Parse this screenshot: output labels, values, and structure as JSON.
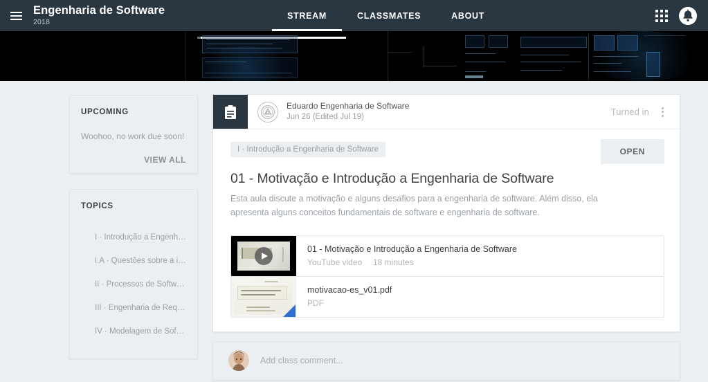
{
  "topbar": {
    "menu_icon": "hamburger-menu-icon",
    "class_name": "Engenharia de Software",
    "class_year": "2018",
    "tabs": [
      {
        "label": "STREAM",
        "active": true
      },
      {
        "label": "CLASSMATES",
        "active": false
      },
      {
        "label": "ABOUT",
        "active": false
      }
    ],
    "apps_icon": "apps-grid-icon",
    "account_icon": "account-avatar-icon"
  },
  "banner": {
    "alt": "class-banner-image"
  },
  "sidebar": {
    "upcoming": {
      "heading": "UPCOMING",
      "message": "Woohoo, no work due soon!",
      "view_all_label": "VIEW ALL"
    },
    "topics": {
      "heading": "TOPICS",
      "items": [
        {
          "label": "I · Introdução a Engenharia..."
        },
        {
          "label": "I.A · Questões sobre a intro..."
        },
        {
          "label": "II · Processos de Software"
        },
        {
          "label": "III · Engenharia de Requisit..."
        },
        {
          "label": "IV · Modelagem de Software"
        }
      ]
    }
  },
  "post": {
    "type_icon": "assignment-clipboard-icon",
    "avatar_icon": "school-seal-icon",
    "author": "Eduardo Engenharia de Software",
    "date": "Jun 26 (Edited Jul 19)",
    "status": "Turned in",
    "menu_icon": "more-options-kebab-icon",
    "topic_chip": "I · Introdução a Engenharia de Software",
    "open_label": "OPEN",
    "title": "01 - Motivação e Introdução a Engenharia de Software",
    "description": "Esta aula discute a motivação e alguns desafios para a engenharia de software. Além disso, ela apresenta alguns conceitos fundamentais de software e engenharia de software.",
    "attachments": [
      {
        "thumb": "video-play-thumbnail",
        "title": "01 - Motivação e Introdução a Engenharia de Software",
        "meta_type": "YouTube video",
        "meta_duration": "18 minutes"
      },
      {
        "thumb": "pdf-document-thumbnail",
        "title": "motivacao-es_v01.pdf",
        "meta_type": "PDF",
        "meta_duration": ""
      }
    ]
  },
  "comment": {
    "avatar_icon": "user-avatar-icon",
    "placeholder": "Add class comment..."
  },
  "colors": {
    "topbar": "#2b3740",
    "page_bg": "#eceff1",
    "card_bg": "#ffffff",
    "accent_pdf": "#2f6fd0",
    "muted_text": "#9aa0a6"
  }
}
